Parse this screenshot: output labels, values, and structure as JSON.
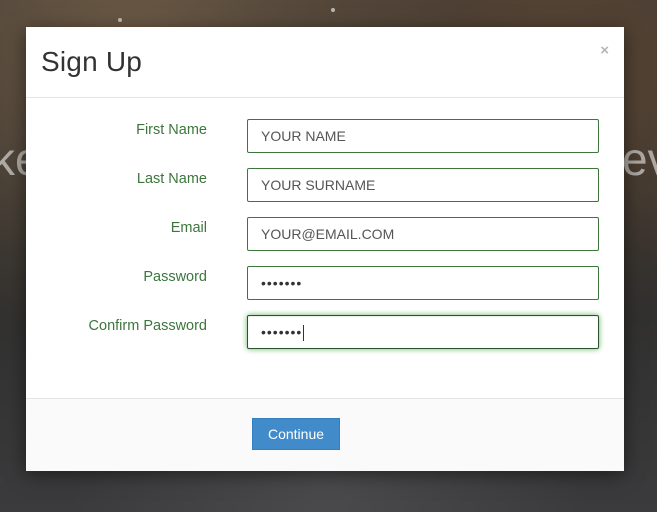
{
  "background": {
    "left_fragment": "ke",
    "right_fragment": "ev"
  },
  "modal": {
    "title": "Sign Up",
    "close_label": "×",
    "fields": [
      {
        "label": "First Name",
        "value": "YOUR NAME",
        "type": "text"
      },
      {
        "label": "Last Name",
        "value": "YOUR SURNAME",
        "type": "text"
      },
      {
        "label": "Email",
        "value": "YOUR@EMAIL.COM",
        "type": "text"
      },
      {
        "label": "Password",
        "value": "•••••••",
        "type": "password"
      },
      {
        "label": "Confirm Password",
        "value": "•••••••",
        "type": "password",
        "focused": true
      }
    ],
    "continue_label": "Continue"
  },
  "colors": {
    "label_green": "#3c763d",
    "button_blue": "#428bca"
  }
}
